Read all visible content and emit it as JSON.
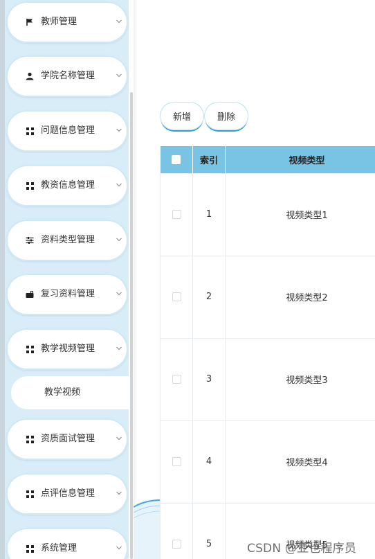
{
  "sidebar": {
    "items": [
      {
        "label": "教师管理",
        "icon": "flag-icon"
      },
      {
        "label": "学院名称管理",
        "icon": "user-icon"
      },
      {
        "label": "问题信息管理",
        "icon": "grid-icon"
      },
      {
        "label": "教资信息管理",
        "icon": "grid-icon"
      },
      {
        "label": "资料类型管理",
        "icon": "sliders-icon"
      },
      {
        "label": "复习资料管理",
        "icon": "briefcase-icon"
      },
      {
        "label": "教学视频管理",
        "icon": "grid-icon"
      },
      {
        "label": "资质面试管理",
        "icon": "grid-icon"
      },
      {
        "label": "点评信息管理",
        "icon": "grid-icon"
      },
      {
        "label": "系统管理",
        "icon": "grid-icon"
      }
    ],
    "subitem": {
      "label": "教学视频"
    }
  },
  "toolbar": {
    "add_label": "新增",
    "delete_label": "删除"
  },
  "table": {
    "headers": [
      "",
      "索引",
      "视频类型"
    ],
    "rows": [
      {
        "index": "1",
        "type": "视频类型1"
      },
      {
        "index": "2",
        "type": "视频类型2"
      },
      {
        "index": "3",
        "type": "视频类型3"
      },
      {
        "index": "4",
        "type": "视频类型4"
      },
      {
        "index": "5",
        "type": "视频类型5"
      }
    ]
  },
  "watermark": "CSDN @亚也程序员",
  "colors": {
    "accent": "#2e9ed6",
    "header_bg": "#79c4e5",
    "sidebar_bg": "#d9edf8"
  }
}
